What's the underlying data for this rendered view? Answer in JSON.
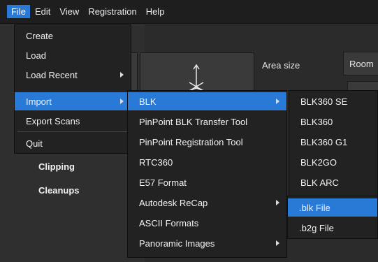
{
  "menubar": {
    "items": [
      "File",
      "Edit",
      "View",
      "Registration",
      "Help"
    ]
  },
  "background": {
    "area_size_label": "Area size",
    "area_size_value": "Room",
    "side_links": [
      "Clipping",
      "Cleanups"
    ]
  },
  "file_menu": {
    "items": [
      "Create",
      "Load",
      "Load Recent",
      "Import",
      "Export Scans",
      "Quit"
    ]
  },
  "import_menu": {
    "items": [
      "BLK",
      "PinPoint BLK Transfer Tool",
      "PinPoint Registration Tool",
      "RTC360",
      "E57 Format",
      "Autodesk ReCap",
      "ASCII Formats",
      "Panoramic Images"
    ]
  },
  "blk_menu": {
    "items": [
      "BLK360 SE",
      "BLK360",
      "BLK360 G1",
      "BLK2GO",
      "BLK ARC"
    ]
  },
  "recap_menu": {
    "items": [
      ".blk File",
      ".b2g File"
    ]
  },
  "colors": {
    "highlight": "#2979d6",
    "menu_bg": "#222222",
    "menubar_bg": "#1e1e1e"
  },
  "icons": [
    "chevron-right-icon",
    "scan-axes-icon"
  ]
}
